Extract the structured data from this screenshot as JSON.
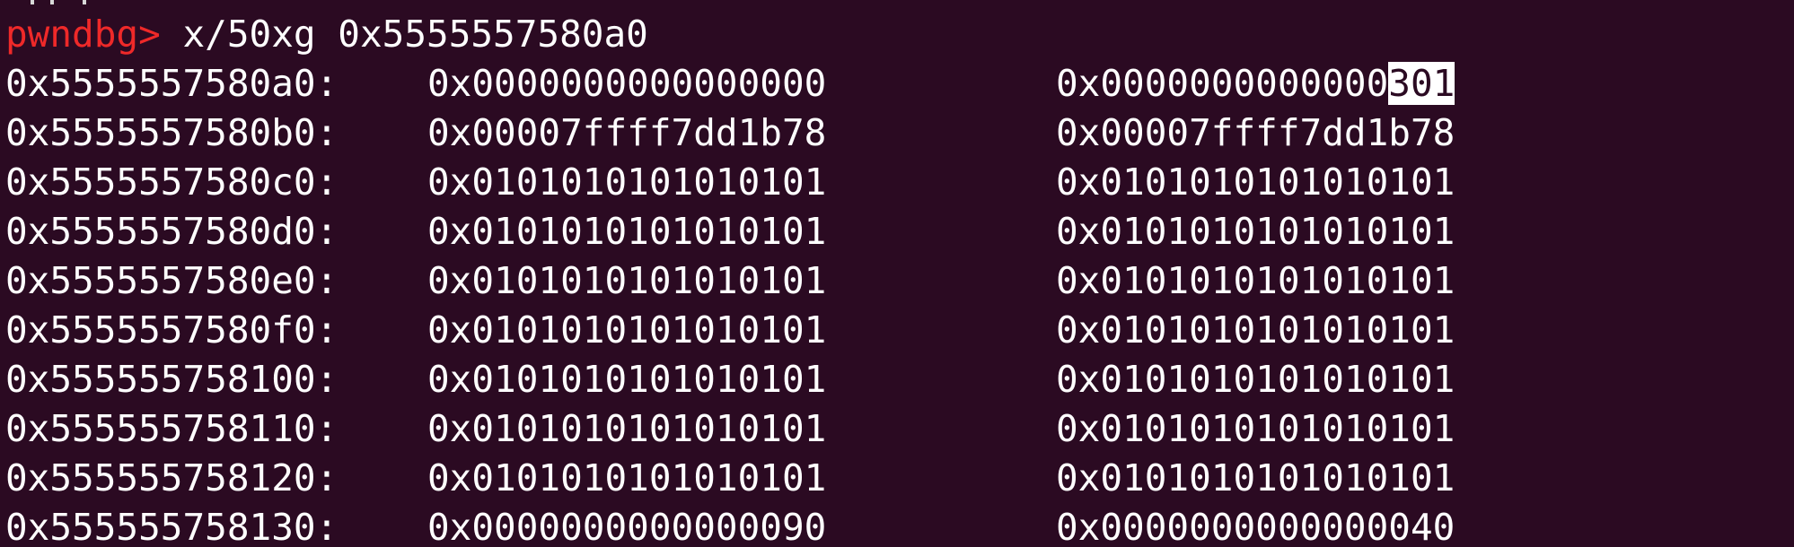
{
  "terminal": {
    "prompt": "pwndbg>",
    "command": "x/50xg 0x5555557580a0",
    "rows": [
      {
        "addr": "0x5555557580a0:",
        "v1": "0x0000000000000000",
        "v2_pre": "0x0000000000000",
        "v2_hl": "301"
      },
      {
        "addr": "0x5555557580b0:",
        "v1": "0x00007ffff7dd1b78",
        "v2": "0x00007ffff7dd1b78"
      },
      {
        "addr": "0x5555557580c0:",
        "v1": "0x0101010101010101",
        "v2": "0x0101010101010101"
      },
      {
        "addr": "0x5555557580d0:",
        "v1": "0x0101010101010101",
        "v2": "0x0101010101010101"
      },
      {
        "addr": "0x5555557580e0:",
        "v1": "0x0101010101010101",
        "v2": "0x0101010101010101"
      },
      {
        "addr": "0x5555557580f0:",
        "v1": "0x0101010101010101",
        "v2": "0x0101010101010101"
      },
      {
        "addr": "0x555555758100:",
        "v1": "0x0101010101010101",
        "v2": "0x0101010101010101"
      },
      {
        "addr": "0x555555758110:",
        "v1": "0x0101010101010101",
        "v2": "0x0101010101010101"
      },
      {
        "addr": "0x555555758120:",
        "v1": "0x0101010101010101",
        "v2": "0x0101010101010101"
      },
      {
        "addr": "0x555555758130:",
        "v1": "0x0000000000000090",
        "v2": "0x0000000000000040"
      }
    ],
    "colors": {
      "background": "#2b0a22",
      "text": "#ffffff",
      "prompt": "#ef2929",
      "highlight_bg": "#ffffff"
    }
  }
}
